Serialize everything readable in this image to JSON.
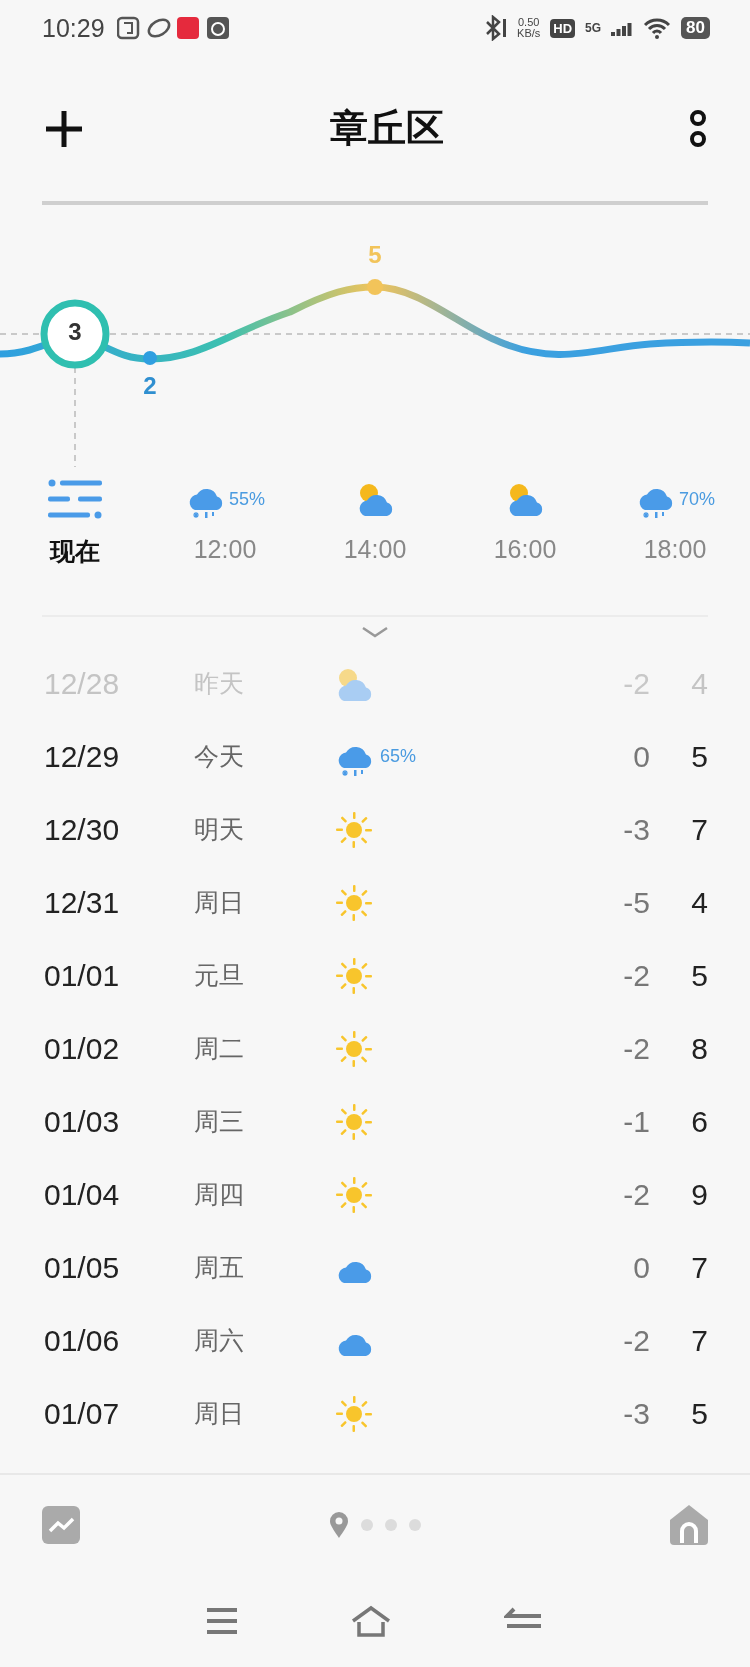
{
  "status_bar": {
    "time": "10:29",
    "net_speed": "0.50",
    "net_unit": "KB/s",
    "hd": "HD",
    "network": "5G",
    "battery": "80"
  },
  "header": {
    "title": "章丘区"
  },
  "trend": {
    "current": "3",
    "min": "2",
    "max": "5"
  },
  "hourly": [
    {
      "kind": "list",
      "label": "现在",
      "selected": true
    },
    {
      "kind": "snow_rain",
      "precip": "55%",
      "label": "12:00",
      "selected": false
    },
    {
      "kind": "partly_cloudy",
      "label": "14:00",
      "selected": false
    },
    {
      "kind": "partly_cloudy",
      "label": "16:00",
      "selected": false
    },
    {
      "kind": "snow_rain",
      "precip": "70%",
      "label": "18:00",
      "selected": false
    }
  ],
  "daily": [
    {
      "date": "12/28",
      "day": "昨天",
      "kind": "partly_cloudy",
      "low": "-2",
      "high": "4",
      "past": true
    },
    {
      "date": "12/29",
      "day": "今天",
      "kind": "snow_rain",
      "precip": "65%",
      "low": "0",
      "high": "5",
      "past": false
    },
    {
      "date": "12/30",
      "day": "明天",
      "kind": "sun",
      "low": "-3",
      "high": "7",
      "past": false
    },
    {
      "date": "12/31",
      "day": "周日",
      "kind": "sun",
      "low": "-5",
      "high": "4",
      "past": false
    },
    {
      "date": "01/01",
      "day": "元旦",
      "kind": "sun",
      "low": "-2",
      "high": "5",
      "past": false
    },
    {
      "date": "01/02",
      "day": "周二",
      "kind": "sun",
      "low": "-2",
      "high": "8",
      "past": false
    },
    {
      "date": "01/03",
      "day": "周三",
      "kind": "sun",
      "low": "-1",
      "high": "6",
      "past": false
    },
    {
      "date": "01/04",
      "day": "周四",
      "kind": "sun",
      "low": "-2",
      "high": "9",
      "past": false
    },
    {
      "date": "01/05",
      "day": "周五",
      "kind": "cloud",
      "low": "0",
      "high": "7",
      "past": false
    },
    {
      "date": "01/06",
      "day": "周六",
      "kind": "cloud",
      "low": "-2",
      "high": "7",
      "past": false
    },
    {
      "date": "01/07",
      "day": "周日",
      "kind": "sun",
      "low": "-3",
      "high": "5",
      "past": false
    }
  ],
  "pager": [
    {
      "kind": "location",
      "selected": true
    },
    {
      "kind": "dot",
      "selected": false
    },
    {
      "kind": "dot",
      "selected": false
    },
    {
      "kind": "dot",
      "selected": false
    }
  ]
}
